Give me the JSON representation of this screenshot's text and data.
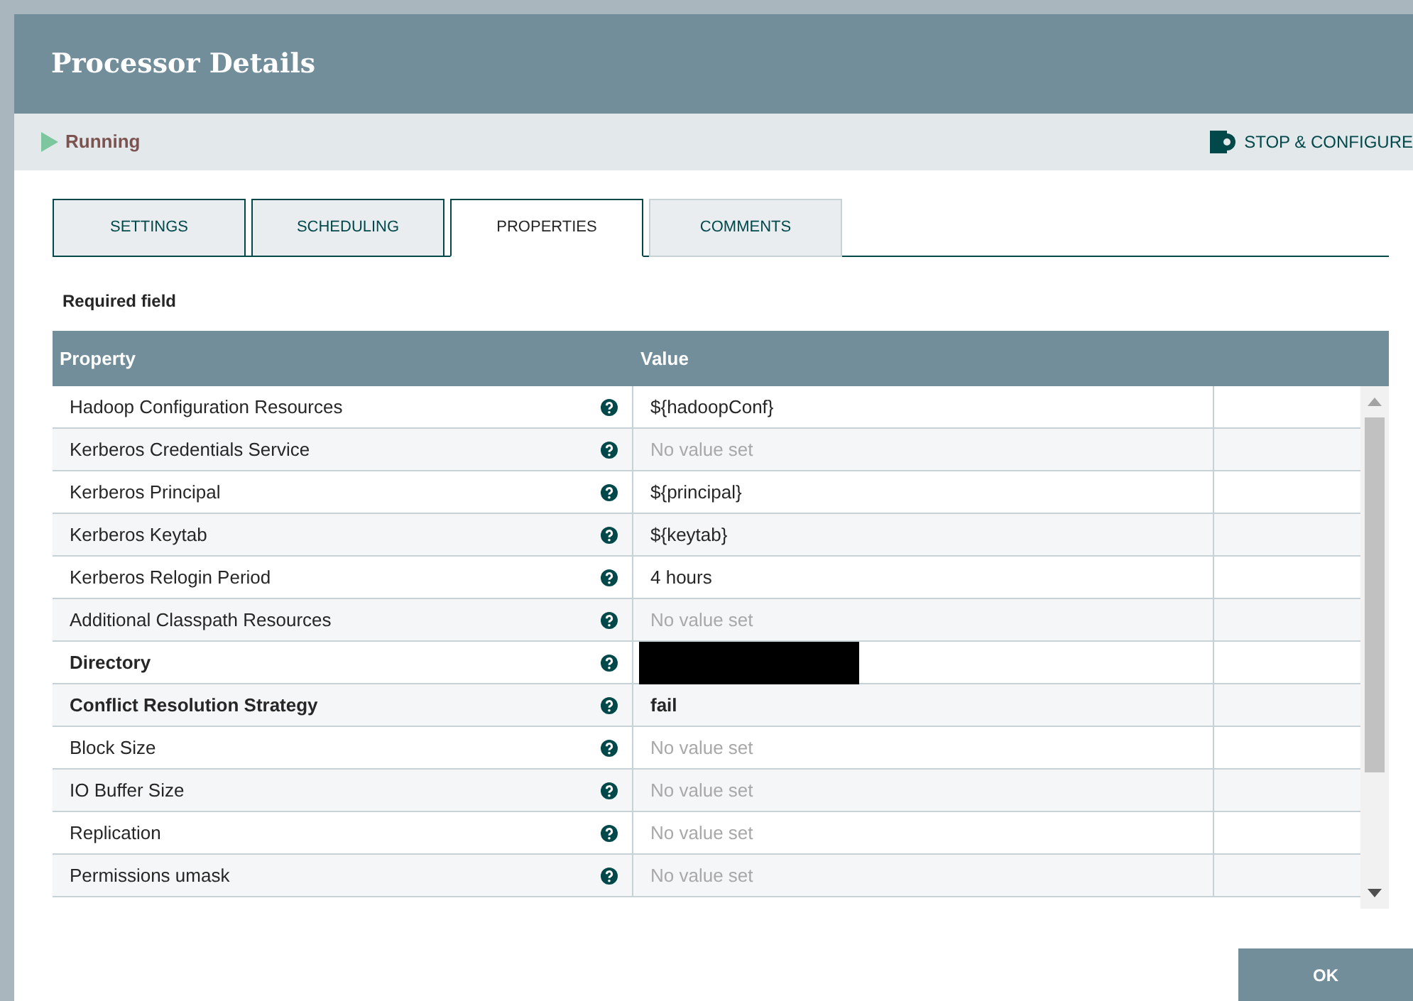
{
  "dialog": {
    "title": "Processor Details"
  },
  "status": {
    "running": true,
    "label": "Running",
    "action": "STOP & CONFIGURE"
  },
  "tabs": [
    {
      "label": "SETTINGS",
      "selected": false
    },
    {
      "label": "SCHEDULING",
      "selected": false
    },
    {
      "label": "PROPERTIES",
      "selected": true
    },
    {
      "label": "COMMENTS",
      "selected": false
    }
  ],
  "required_note": "Required field",
  "table": {
    "columns": [
      "Property",
      "Value"
    ],
    "rows": [
      {
        "property": "Hadoop Configuration Resources",
        "required": false,
        "value": "${hadoopConf}",
        "set": true
      },
      {
        "property": "Kerberos Credentials Service",
        "required": false,
        "value": "No value set",
        "set": false
      },
      {
        "property": "Kerberos Principal",
        "required": false,
        "value": "${principal}",
        "set": true
      },
      {
        "property": "Kerberos Keytab",
        "required": false,
        "value": "${keytab}",
        "set": true
      },
      {
        "property": "Kerberos Relogin Period",
        "required": false,
        "value": "4 hours",
        "set": true
      },
      {
        "property": "Additional Classpath Resources",
        "required": false,
        "value": "No value set",
        "set": false
      },
      {
        "property": "Directory",
        "required": true,
        "kind": "redacted",
        "set": true
      },
      {
        "property": "Conflict Resolution Strategy",
        "required": true,
        "value": "fail",
        "set": true
      },
      {
        "property": "Block Size",
        "required": false,
        "value": "No value set",
        "set": false
      },
      {
        "property": "IO Buffer Size",
        "required": false,
        "value": "No value set",
        "set": false
      },
      {
        "property": "Replication",
        "required": false,
        "value": "No value set",
        "set": false
      },
      {
        "property": "Permissions umask",
        "required": false,
        "value": "No value set",
        "set": false
      }
    ]
  },
  "buttons": [
    "OK"
  ]
}
